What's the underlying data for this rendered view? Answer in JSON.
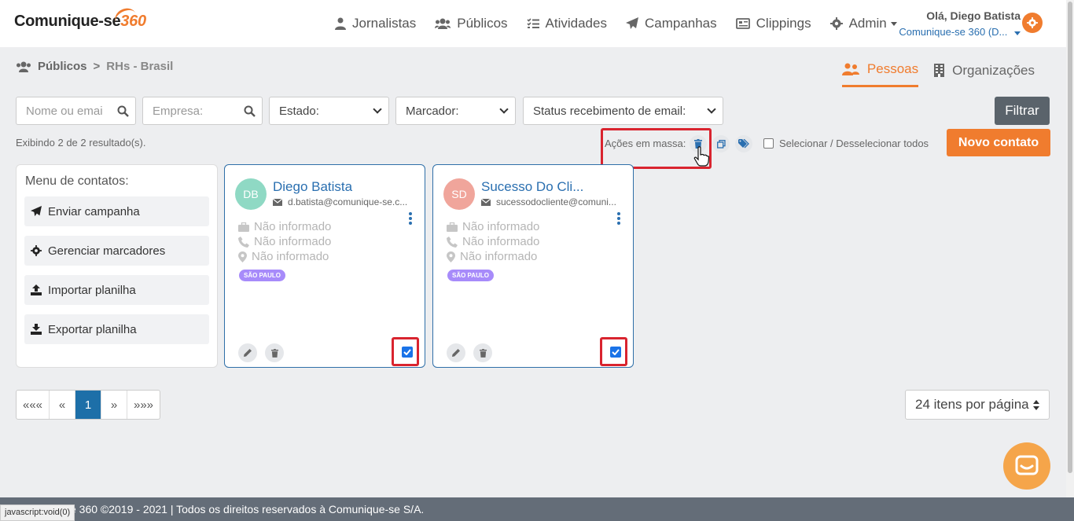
{
  "header": {
    "logo_text": "Comunique-se",
    "logo_num": "360",
    "nav": [
      "Jornalistas",
      "Públicos",
      "Atividades",
      "Campanhas",
      "Clippings",
      "Admin"
    ],
    "greeting": "Olá, Diego Batista",
    "org": "Comunique-se 360 (D..."
  },
  "breadcrumb": {
    "parent": "Públicos",
    "sep": ">",
    "current": "RHs - Brasil"
  },
  "tabs": {
    "people": "Pessoas",
    "orgs": "Organizações"
  },
  "filters": {
    "name_placeholder": "Nome ou emai",
    "company_placeholder": "Empresa:",
    "state": "Estado:",
    "tag": "Marcador:",
    "email_status": "Status recebimento de email:",
    "filter_button": "Filtrar"
  },
  "results": "Exibindo 2 de 2 resultado(s).",
  "mass_actions": {
    "label": "Ações em massa:",
    "select_all": "Selecionar / Desselecionar todos"
  },
  "new_contact": "Novo contato",
  "menu": {
    "title": "Menu de contatos:",
    "items": [
      "Enviar campanha",
      "Gerenciar marcadores",
      "Importar planilha",
      "Exportar planilha"
    ]
  },
  "contacts": [
    {
      "initials": "DB",
      "name": "Diego Batista",
      "email": "d.batista@comunique-se.c...",
      "company": "Não informado",
      "phone": "Não informado",
      "location": "Não informado",
      "tag": "SÃO PAULO",
      "avatar_color": "#8fd9c4"
    },
    {
      "initials": "SD",
      "name": "Sucesso Do Cli...",
      "email": "sucessodocliente@comuni...",
      "company": "Não informado",
      "phone": "Não informado",
      "location": "Não informado",
      "tag": "SÃO PAULO",
      "avatar_color": "#f0a59b"
    }
  ],
  "pagination": {
    "first": "«««",
    "prev": "«",
    "page": "1",
    "next": "»",
    "last": "»»»",
    "per_page": "24 itens por página"
  },
  "footer": "se 360 ©2019 - 2021 | Todos os direitos reservados à Comunique-se S/A.",
  "status_url": "javascript:void(0)",
  "colors": {
    "accent": "#f07c2e",
    "primary": "#2a6fb0",
    "highlight": "#d9242f"
  }
}
